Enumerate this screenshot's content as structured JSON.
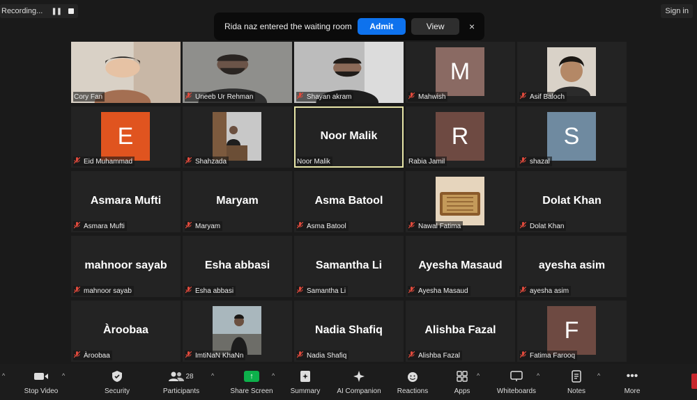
{
  "recording": {
    "label": "Recording...",
    "pause_icon": "pause-icon",
    "stop_icon": "stop-icon"
  },
  "header": {
    "signin": "Sign in"
  },
  "notification": {
    "message": "Rida naz entered the waiting room",
    "admit": "Admit",
    "view": "View",
    "close": "×"
  },
  "tiles": [
    {
      "name": "Cory Fan",
      "type": "photo",
      "mic_muted": false
    },
    {
      "name": "Uneeb Ur Rehman",
      "type": "photo",
      "mic_muted": true
    },
    {
      "name": "Shayan akram",
      "type": "photo",
      "mic_muted": true
    },
    {
      "name": "Mahwish",
      "type": "letter",
      "letter": "M",
      "color": "#8a6a63",
      "mic_muted": true
    },
    {
      "name": "Asif Baloch",
      "type": "photo",
      "mic_muted": true
    },
    {
      "name": "Eid Muhammad",
      "type": "letter",
      "letter": "E",
      "color": "#e0541f",
      "mic_muted": true
    },
    {
      "name": "Shahzada",
      "type": "photo",
      "mic_muted": true
    },
    {
      "name": "Noor Malik",
      "type": "name",
      "active": true,
      "mic_muted": false
    },
    {
      "name": "Rabia Jamil",
      "type": "letter",
      "letter": "R",
      "color": "#6e4a42",
      "mic_muted": false
    },
    {
      "name": "shazal",
      "type": "letter",
      "letter": "S",
      "color": "#6f8aa0",
      "mic_muted": true
    },
    {
      "name": "Asmara Mufti",
      "type": "name",
      "mic_muted": true
    },
    {
      "name": "Maryam",
      "type": "name",
      "mic_muted": true
    },
    {
      "name": "Asma Batool",
      "type": "name",
      "mic_muted": true
    },
    {
      "name": "Nawal Fatima",
      "type": "photo",
      "mic_muted": true
    },
    {
      "name": "Dolat Khan",
      "type": "name",
      "mic_muted": true
    },
    {
      "name": "mahnoor sayab",
      "type": "name",
      "mic_muted": true
    },
    {
      "name": "Esha abbasi",
      "type": "name",
      "mic_muted": true
    },
    {
      "name": "Samantha Li",
      "type": "name",
      "mic_muted": true
    },
    {
      "name": "Ayesha Masaud",
      "type": "name",
      "mic_muted": true
    },
    {
      "name": "ayesha asim",
      "type": "name",
      "mic_muted": true
    },
    {
      "name": "Àroobaa",
      "type": "name",
      "mic_muted": true
    },
    {
      "name": "ImtiNaN KhaNn",
      "type": "photo",
      "mic_muted": true
    },
    {
      "name": "Nadia Shafiq",
      "type": "name",
      "mic_muted": true
    },
    {
      "name": "Alishba Fazal",
      "type": "name",
      "mic_muted": true
    },
    {
      "name": "Fatima Farooq",
      "type": "letter",
      "letter": "F",
      "color": "#6e4a42",
      "mic_muted": true
    }
  ],
  "toolbar": {
    "stop_video": "Stop Video",
    "security": "Security",
    "participants": "Participants",
    "participants_count": "28",
    "share_screen": "Share Screen",
    "summary": "Summary",
    "ai_companion": "AI Companion",
    "reactions": "Reactions",
    "apps": "Apps",
    "whiteboards": "Whiteboards",
    "notes": "Notes",
    "more": "More"
  },
  "colors": {
    "accent": "#0e72ed",
    "share_green": "#0db14b",
    "end_red": "#c7262c",
    "active_border": "#e8e6a8"
  }
}
